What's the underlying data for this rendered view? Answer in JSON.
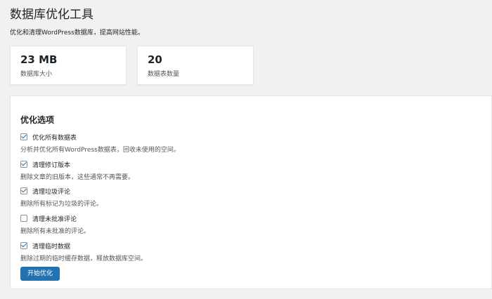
{
  "header": {
    "title": "数据库优化工具",
    "description": "优化和清理WordPress数据库，提高网站性能。"
  },
  "stats": [
    {
      "value": "23 MB",
      "label": "数据库大小"
    },
    {
      "value": "20",
      "label": "数据表数量"
    }
  ],
  "options_panel": {
    "title": "优化选项",
    "options": [
      {
        "label": "优化所有数据表",
        "description": "分析并优化所有WordPress数据表，回收未使用的空间。",
        "checked": true
      },
      {
        "label": "清理修订版本",
        "description": "删除文章的旧版本，这些通常不再需要。",
        "checked": true
      },
      {
        "label": "清理垃圾评论",
        "description": "删除所有标记为垃圾的评论。",
        "checked": true
      },
      {
        "label": "清理未批准评论",
        "description": "删除所有未批准的评论。",
        "checked": false
      },
      {
        "label": "清理临时数据",
        "description": "删除过期的临时缓存数据，释放数据库空间。",
        "checked": true
      }
    ],
    "submit_label": "开始优化"
  },
  "colors": {
    "background": "#f1f1f1",
    "card": "#ffffff",
    "accent": "#2271b1",
    "text": "#1d2327",
    "muted_text": "#50575e"
  }
}
